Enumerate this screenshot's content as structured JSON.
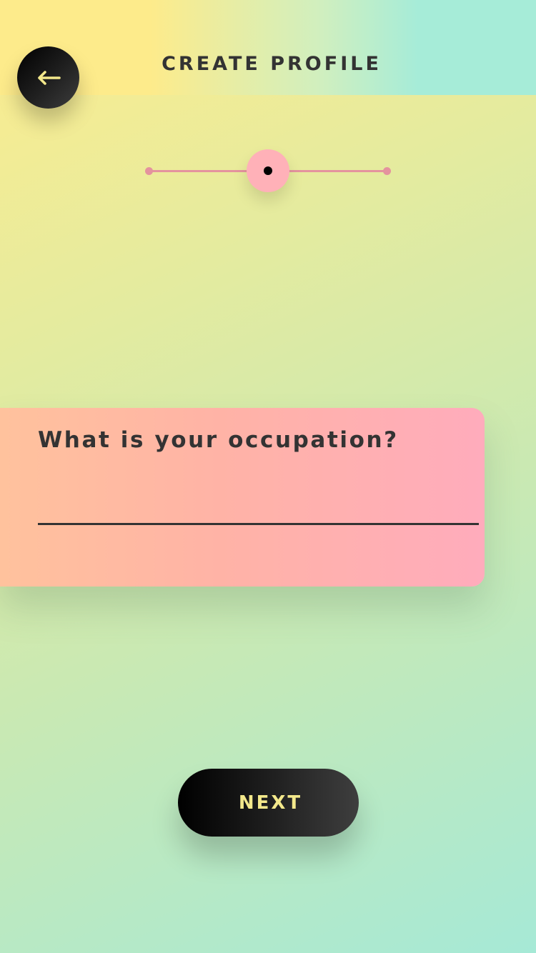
{
  "header": {
    "title": "CREATE PROFILE",
    "back_icon": "arrow-left-icon"
  },
  "progress": {
    "total_steps": 3,
    "current_step": 2
  },
  "question": {
    "label": "What is your occupation?",
    "value": ""
  },
  "footer": {
    "next_label": "NEXT"
  },
  "colors": {
    "accent_pink": "#ffb1b8",
    "track_pink": "#e4939e",
    "button_text": "#f3e88b",
    "text_dark": "#333333"
  }
}
